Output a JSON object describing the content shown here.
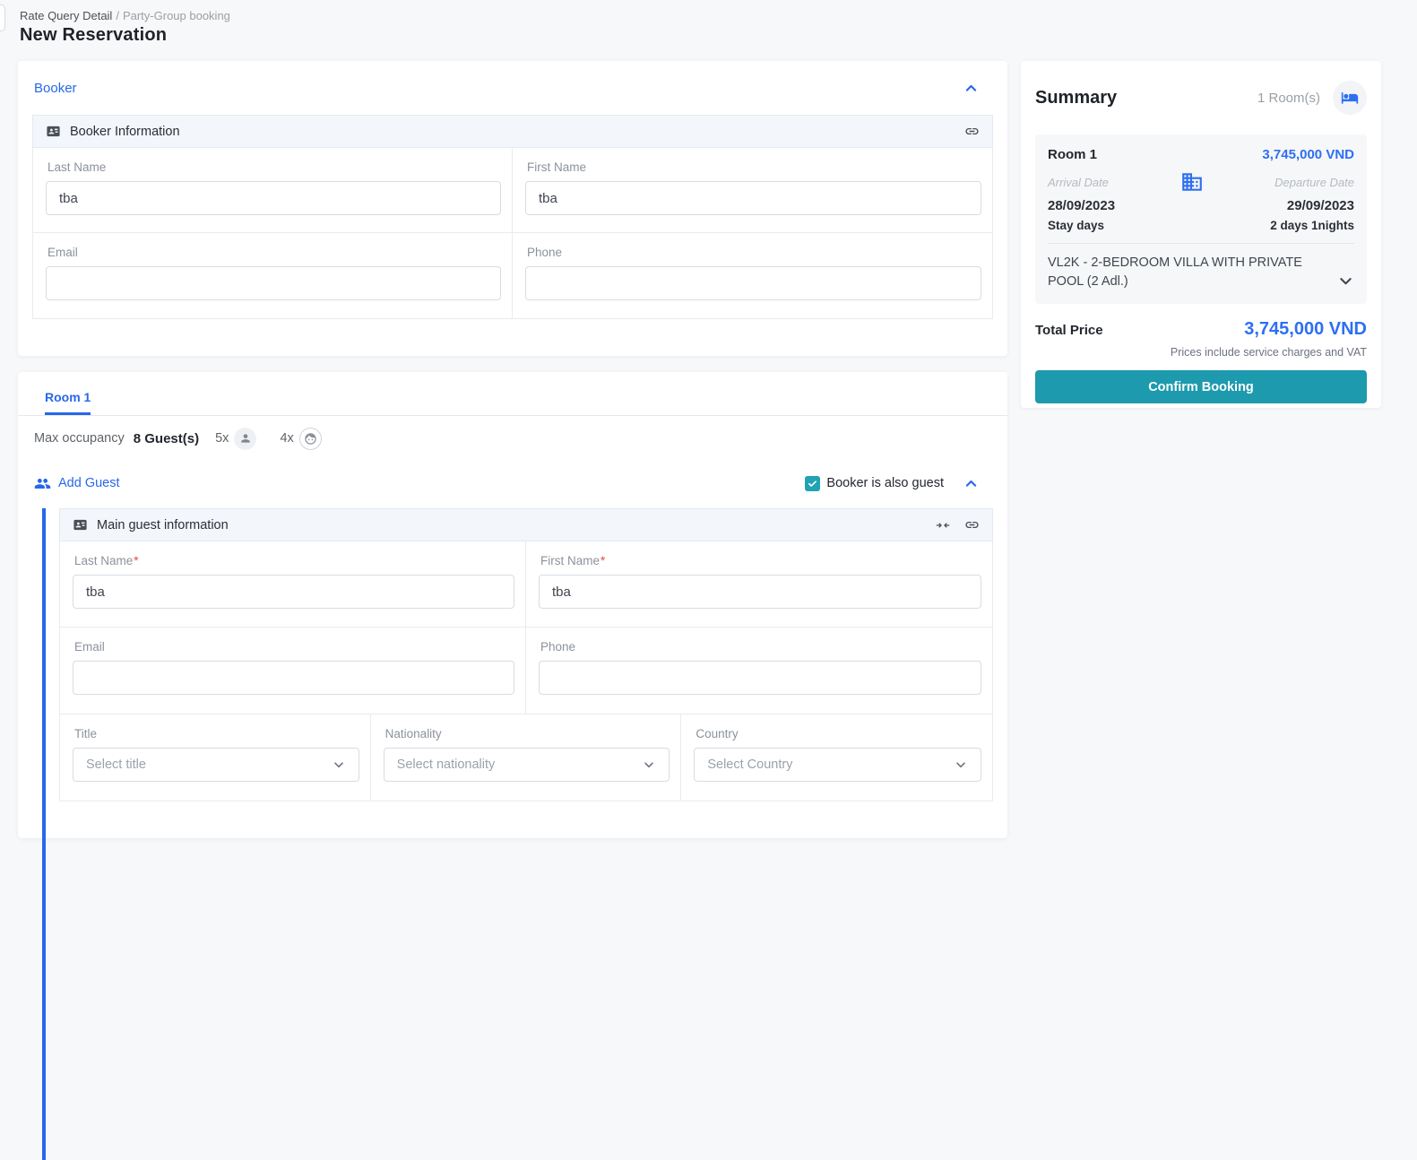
{
  "breadcrumb": {
    "parent": "Rate Query Detail",
    "separator": "/",
    "current": "Party-Group booking"
  },
  "page_title": "New Reservation",
  "booker": {
    "section_title": "Booker",
    "panel_title": "Booker Information",
    "fields": {
      "last_name": {
        "label": "Last Name",
        "value": "tba"
      },
      "first_name": {
        "label": "First Name",
        "value": "tba"
      },
      "email": {
        "label": "Email",
        "value": ""
      },
      "phone": {
        "label": "Phone",
        "value": ""
      }
    }
  },
  "room": {
    "tab_label": "Room 1",
    "occupancy": {
      "label": "Max occupancy",
      "total": "8 Guest(s)",
      "adults_count": "5x",
      "children_count": "4x"
    },
    "add_guest_label": "Add Guest",
    "booker_is_guest_label": "Booker is also guest",
    "guest_panel": {
      "title": "Main guest information",
      "fields": {
        "last_name": {
          "label": "Last Name",
          "required": "*",
          "value": "tba"
        },
        "first_name": {
          "label": "First Name",
          "required": "*",
          "value": "tba"
        },
        "email": {
          "label": "Email",
          "value": ""
        },
        "phone": {
          "label": "Phone",
          "value": ""
        },
        "title": {
          "label": "Title",
          "placeholder": "Select title"
        },
        "nationality": {
          "label": "Nationality",
          "placeholder": "Select nationality"
        },
        "country": {
          "label": "Country",
          "placeholder": "Select Country"
        }
      }
    }
  },
  "summary": {
    "title": "Summary",
    "rooms_count": "1 Room(s)",
    "room_card": {
      "name": "Room 1",
      "price": "3,745,000 VND",
      "arrival_label": "Arrival Date",
      "departure_label": "Departure Date",
      "arrival_date": "28/09/2023",
      "departure_date": "29/09/2023",
      "stay_label": "Stay days",
      "stay_value": "2 days 1nights",
      "room_type": "VL2K - 2-BEDROOM VILLA WITH PRIVATE POOL (2 Adl.)"
    },
    "total_label": "Total Price",
    "total_value": "3,745,000 VND",
    "vat_note": "Prices include service charges and VAT",
    "confirm_button": "Confirm Booking"
  },
  "colors": {
    "primary_blue": "#2767ec",
    "price_blue": "#2e6ff2",
    "teal_button": "#1d9aad",
    "teal_checkbox": "#1fa3b5",
    "required_red": "#e5483f",
    "page_background": "#f7f8f9"
  },
  "icons": {
    "id_card": "id-card-icon",
    "link": "link-icon",
    "chevron_up": "chevron-up-icon",
    "chevron_down": "chevron-down-icon",
    "adult": "person-icon",
    "child": "child-face-icon",
    "group": "add-guest-people-icon",
    "bed": "bed-icon",
    "building": "building-icon",
    "compress": "compress-icon",
    "checkmark": "check-icon"
  }
}
